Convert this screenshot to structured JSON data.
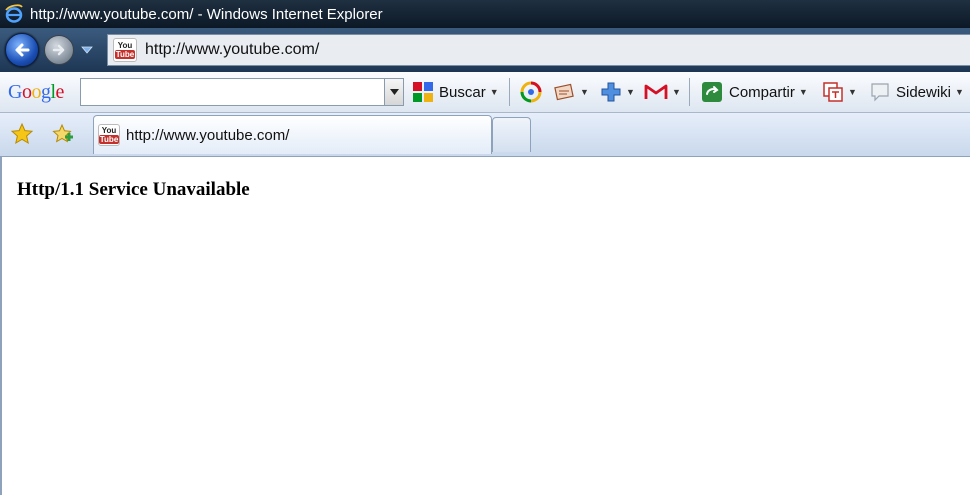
{
  "window": {
    "title": "http://www.youtube.com/ - Windows Internet Explorer"
  },
  "address_bar": {
    "url": "http://www.youtube.com/"
  },
  "favicon": {
    "top": "You",
    "bottom": "Tube"
  },
  "google_toolbar": {
    "logo": "Google",
    "search_value": "",
    "buscar_label": "Buscar",
    "compartir_label": "Compartir",
    "sidewiki_label": "Sidewiki"
  },
  "tabs": [
    {
      "label": "http://www.youtube.com/"
    }
  ],
  "page": {
    "error_text": "Http/1.1 Service Unavailable"
  },
  "colors": {
    "google_blue": "#3369e8",
    "google_red": "#d50f25",
    "google_yellow": "#eeb211",
    "google_green": "#009925",
    "youtube_red": "#c4302b"
  }
}
